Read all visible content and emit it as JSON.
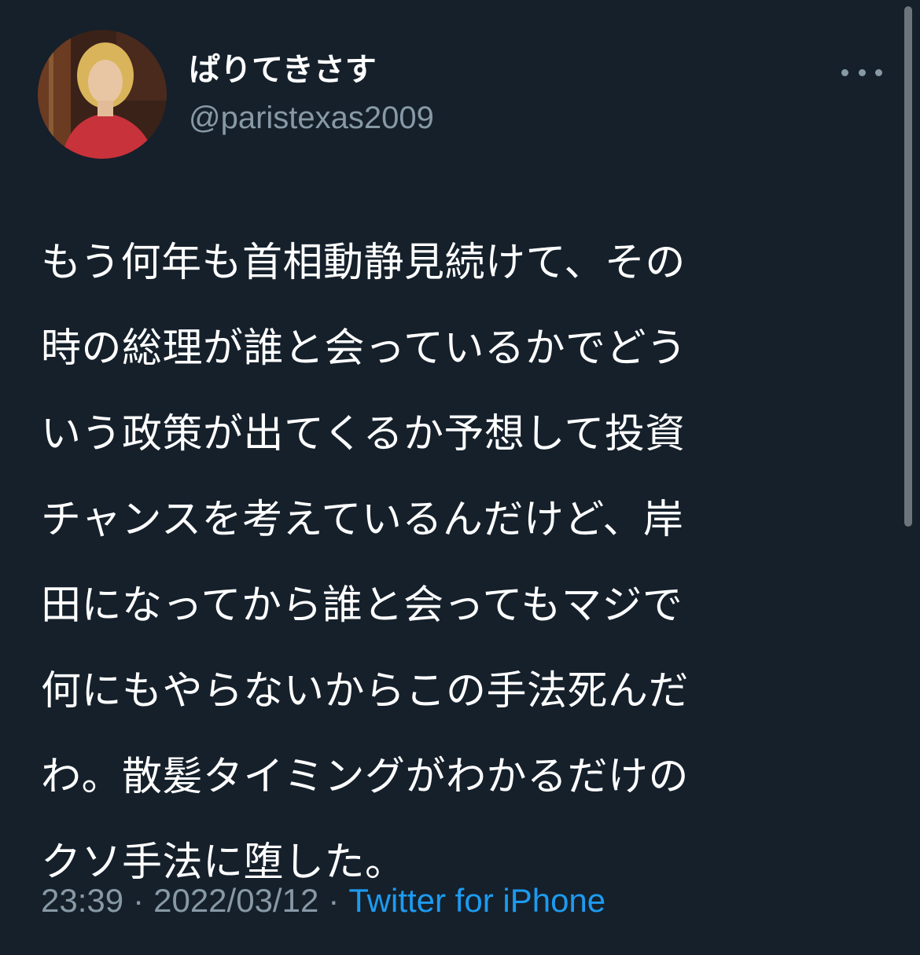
{
  "user": {
    "display_name": "ぱりてきさす",
    "handle": "@paristexas2009"
  },
  "tweet": {
    "lines": [
      "もう何年も首相動静見続けて、その",
      "時の総理が誰と会っているかでどう",
      "いう政策が出てくるか予想して投資",
      "チャンスを考えているんだけど、岸",
      "田になってから誰と会ってもマジで",
      "何にもやらないからこの手法死んだ",
      "わ。散髪タイミングがわかるだけの",
      "クソ手法に堕した。"
    ],
    "time": "23:39",
    "separator": "·",
    "date": "2022/03/12",
    "source": "Twitter for iPhone"
  },
  "colors": {
    "background": "#15202b",
    "text": "#ffffff",
    "secondary": "#8899a6",
    "accent": "#1d9bf0"
  },
  "icons": {
    "more": "more-horizontal-icon"
  }
}
